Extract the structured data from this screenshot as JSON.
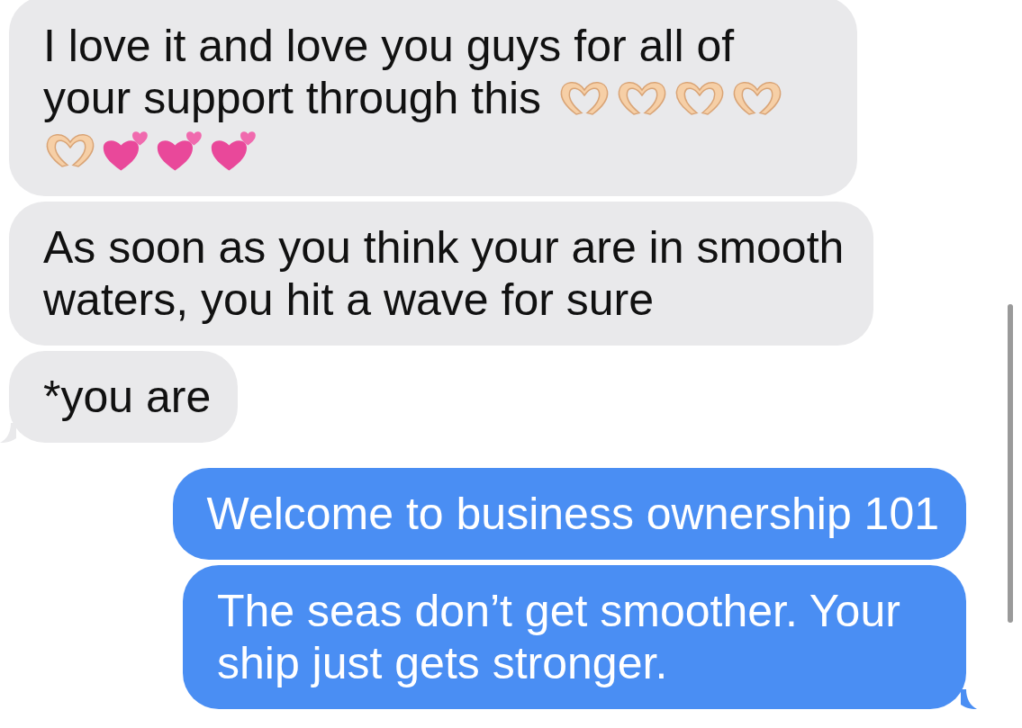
{
  "messages": [
    {
      "outgoing": false,
      "lines": [
        "I love it and love you guys for all of",
        "your support through this"
      ],
      "emoji": [
        {
          "kind": "heart-hands"
        },
        {
          "kind": "heart-hands"
        },
        {
          "kind": "heart-hands"
        },
        {
          "kind": "heart-hands"
        },
        {
          "kind": "heart-hands"
        },
        {
          "kind": "two-hearts"
        },
        {
          "kind": "two-hearts"
        },
        {
          "kind": "two-hearts"
        }
      ],
      "tail": false
    },
    {
      "outgoing": false,
      "text": "As soon as you think your are in smooth waters, you hit a wave for sure",
      "tail": false
    },
    {
      "outgoing": false,
      "text": "*you are",
      "tail": true
    },
    {
      "outgoing": true,
      "text": "Welcome to business ownership 101",
      "tail": false
    },
    {
      "outgoing": true,
      "text": "The seas don’t get smoother. Your ship just gets stronger.",
      "tail": true
    }
  ]
}
